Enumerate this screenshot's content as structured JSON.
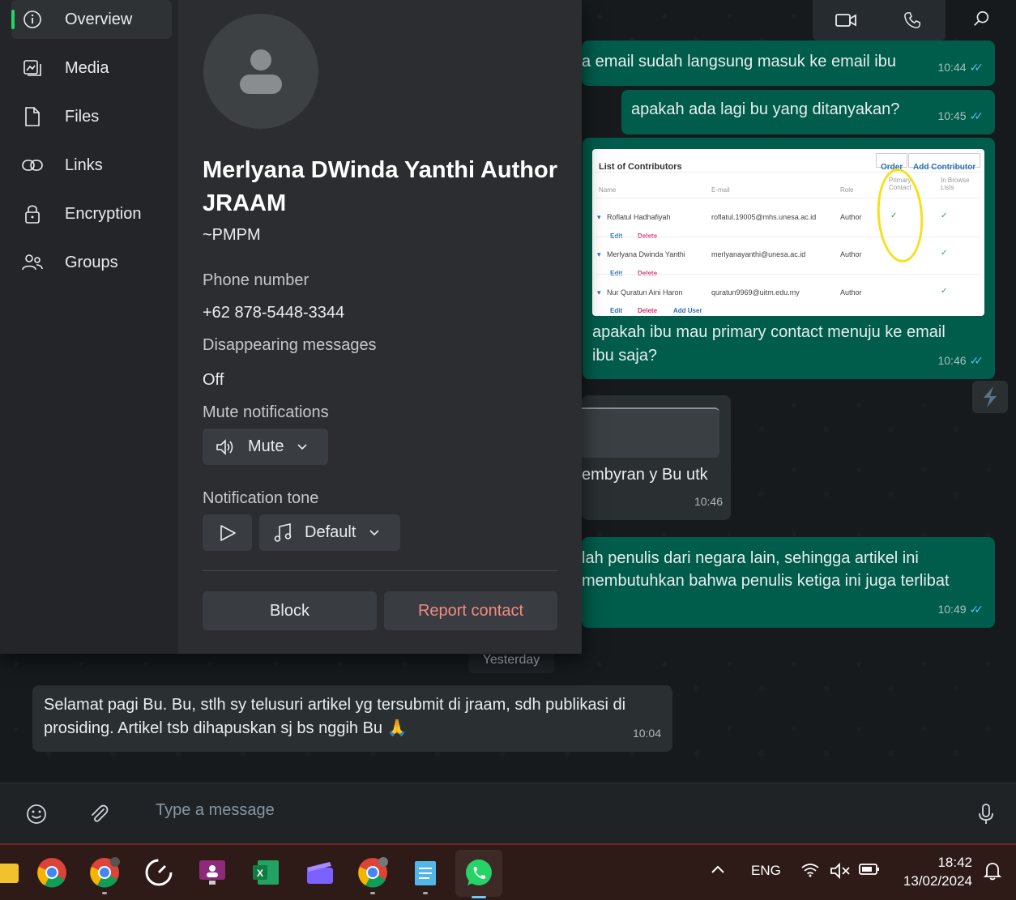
{
  "header": {
    "video_icon": "video-camera-icon",
    "call_icon": "phone-icon",
    "search_icon": "search-icon"
  },
  "messages": [
    {
      "text": "a email sudah langsung masuk ke email ibu",
      "time": "10:44",
      "ticks": "✓✓"
    },
    {
      "text": "apakah ada lagi bu yang ditanyakan?",
      "time": "10:45",
      "ticks": "✓✓"
    },
    {
      "text": "apakah ibu mau primary contact menuju ke email ibu saja?",
      "time": "10:46",
      "ticks": "✓✓"
    },
    {
      "text": "embyran y Bu utk",
      "time": "10:46"
    },
    {
      "text": "lah penulis dari negara lain, sehingga artikel ini",
      "text2": "membutuhkan bahwa penulis ketiga ini juga terlibat",
      "time": "10:49",
      "ticks": "✓✓"
    },
    {
      "text": "Selamat pagi Bu. Bu, stlh sy telusuri artikel yg tersubmit di jraam, sdh publikasi di",
      "text2": "prosiding. Artikel tsb dihapuskan sj bs nggih Bu 🙏",
      "time": "10:04"
    }
  ],
  "contributors_card": {
    "title": "List of Contributors",
    "buttons": [
      "Order",
      "Add Contributor"
    ],
    "columns": [
      "Name",
      "E-mail",
      "Role",
      "Primary Contact",
      "In Browse Lists"
    ],
    "rows": [
      {
        "name": "Roflatul Hadhafiyah",
        "email": "roflatul.19005@mhs.unesa.ac.id",
        "role": "Author"
      },
      {
        "name": "Merlyana Dwinda Yanthi",
        "email": "merlyanayanthi@unesa.ac.id",
        "role": "Author"
      },
      {
        "name": "Nur Quratun Aini Haron",
        "email": "quratun9969@uitm.edu.my",
        "role": "Author"
      }
    ],
    "edit": "Edit",
    "delete": "Delete",
    "add_user": "Add User",
    "check": "✓"
  },
  "day_separator": "Yesterday",
  "compose": {
    "placeholder": "Type a message"
  },
  "panel": {
    "nav": [
      {
        "label": "Overview",
        "icon": "info-icon"
      },
      {
        "label": "Media",
        "icon": "media-icon"
      },
      {
        "label": "Files",
        "icon": "file-icon"
      },
      {
        "label": "Links",
        "icon": "link-icon"
      },
      {
        "label": "Encryption",
        "icon": "lock-icon"
      },
      {
        "label": "Groups",
        "icon": "groups-icon"
      }
    ],
    "contact_name": "Merlyana DWinda Yanthi Author JRAAM",
    "push_name": "~PMPM",
    "phone_label": "Phone number",
    "phone": "+62 878-5448-3344",
    "disappearing_label": "Disappearing messages",
    "disappearing_value": "Off",
    "mute_label": "Mute notifications",
    "mute_value": "Mute",
    "tone_label": "Notification tone",
    "tone_value": "Default",
    "block_label": "Block",
    "report_label": "Report contact"
  },
  "taskbar": {
    "language": "ENG",
    "time": "18:42",
    "date": "13/02/2024"
  },
  "colors": {
    "accent": "#25d366",
    "outgoing": "#005c4b",
    "danger": "#f28b82",
    "tick": "#53bdeb"
  }
}
